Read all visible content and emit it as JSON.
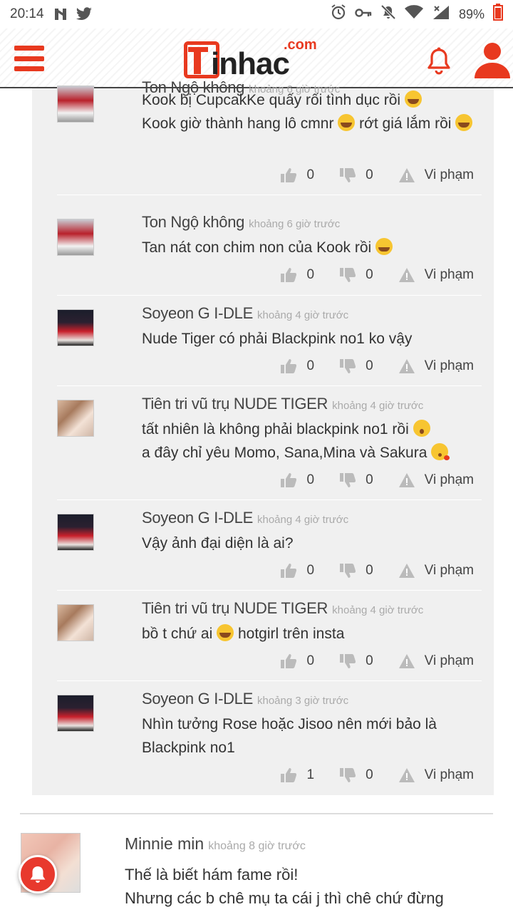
{
  "status_bar": {
    "time": "20:14",
    "battery": "89%"
  },
  "header": {
    "logo_text": "inhac",
    "logo_domain": ".com",
    "menu_icon": "hamburger-icon",
    "bell_icon": "bell-icon",
    "user_icon": "user-icon"
  },
  "colors": {
    "brand": "#e8391f",
    "reply_bg": "#f0f0f0",
    "muted": "#aaaaaa"
  },
  "replies": [
    {
      "name": "Ton Ngộ không",
      "time": "khoảng 6 giờ trước",
      "avatar": "red",
      "lines": [
        "Kook bị CupcakKe quấy rối tình dục rồi",
        "Kook giờ thành hang lô cmnr",
        "rớt giá lắm rồi"
      ],
      "likes": "0",
      "dislikes": "0",
      "report": "Vi phạm"
    },
    {
      "name": "Ton Ngộ không",
      "time": "khoảng 6 giờ trước",
      "avatar": "red",
      "lines": [
        "Tan nát con chim non của Kook rồi"
      ],
      "likes": "0",
      "dislikes": "0",
      "report": "Vi phạm"
    },
    {
      "name": "Soyeon G I-DLE",
      "time": "khoảng 4 giờ trước",
      "avatar": "dark",
      "lines": [
        "Nude Tiger có phải Blackpink no1 ko vậy"
      ],
      "likes": "0",
      "dislikes": "0",
      "report": "Vi phạm"
    },
    {
      "name": "Tiên tri vũ trụ NUDE TIGER",
      "time": "khoảng 4 giờ trước",
      "avatar": "light",
      "lines": [
        "tất nhiên là không phải blackpink no1 rồi",
        "a đây chỉ yêu Momo, Sana,Mina và Sakura"
      ],
      "likes": "0",
      "dislikes": "0",
      "report": "Vi phạm"
    },
    {
      "name": "Soyeon G I-DLE",
      "time": "khoảng 4 giờ trước",
      "avatar": "dark",
      "lines": [
        "Vậy ảnh đại diện là ai?"
      ],
      "likes": "0",
      "dislikes": "0",
      "report": "Vi phạm"
    },
    {
      "name": "Tiên tri vũ trụ NUDE TIGER",
      "time": "khoảng 4 giờ trước",
      "avatar": "light",
      "lines": [
        "bồ t chứ ai",
        "hotgirl trên insta"
      ],
      "likes": "0",
      "dislikes": "0",
      "report": "Vi phạm"
    },
    {
      "name": "Soyeon G I-DLE",
      "time": "khoảng 3 giờ trước",
      "avatar": "dark",
      "lines": [
        "Nhìn tưởng Rose hoặc Jisoo nên mới bảo là",
        "Blackpink no1"
      ],
      "likes": "1",
      "dislikes": "0",
      "report": "Vi phạm"
    }
  ],
  "main_comment": {
    "name": "Minnie min",
    "time": "khoảng 8 giờ trước",
    "lines": [
      "Thế là biết hám fame rồi!",
      "Nhưng các b chê mụ ta cái j thì chê chứ đừng"
    ]
  }
}
